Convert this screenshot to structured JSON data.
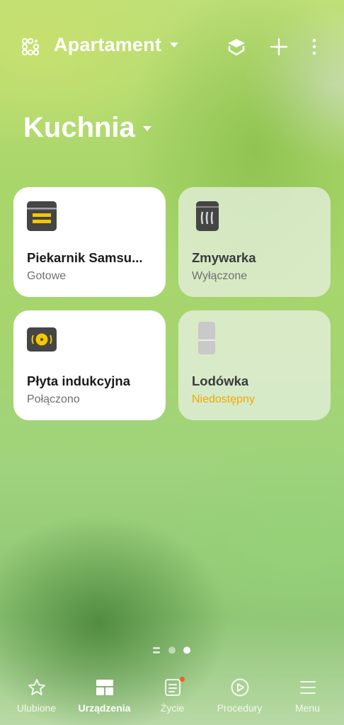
{
  "header": {
    "home_name": "Apartament",
    "icons": [
      "home-layout-icon",
      "caret-down-icon",
      "3d-map-icon",
      "plus-icon",
      "more-vertical-icon"
    ]
  },
  "room": {
    "name": "Kuchnia"
  },
  "devices": [
    {
      "name": "Piekarnik Samsu...",
      "status": "Gotowe",
      "state": "on",
      "icon": "oven-icon"
    },
    {
      "name": "Zmywarka",
      "status": "Wyłączone",
      "state": "off",
      "icon": "dishwasher-icon"
    },
    {
      "name": "Płyta indukcyjna",
      "status": "Połączono",
      "state": "on",
      "icon": "cooktop-icon"
    },
    {
      "name": "Lodówka",
      "status": "Niedostępny",
      "state": "unavailable",
      "icon": "fridge-icon"
    }
  ],
  "pager": {
    "pages": 3,
    "current": 3
  },
  "bottom_nav": {
    "active": "Urządzenia",
    "items": [
      {
        "label": "Ulubione",
        "icon": "star-icon"
      },
      {
        "label": "Urządzenia",
        "icon": "devices-grid-icon"
      },
      {
        "label": "Życie",
        "icon": "life-icon"
      },
      {
        "label": "Procedury",
        "icon": "play-circle-icon"
      },
      {
        "label": "Menu",
        "icon": "hamburger-menu-icon"
      }
    ]
  },
  "colors": {
    "card_on": "#ffffff",
    "card_off": "#ebf2e8",
    "device_accent": "#f6c700",
    "device_dark": "#454545",
    "status_warning": "#f0a800",
    "badge": "#ff5a1f"
  }
}
